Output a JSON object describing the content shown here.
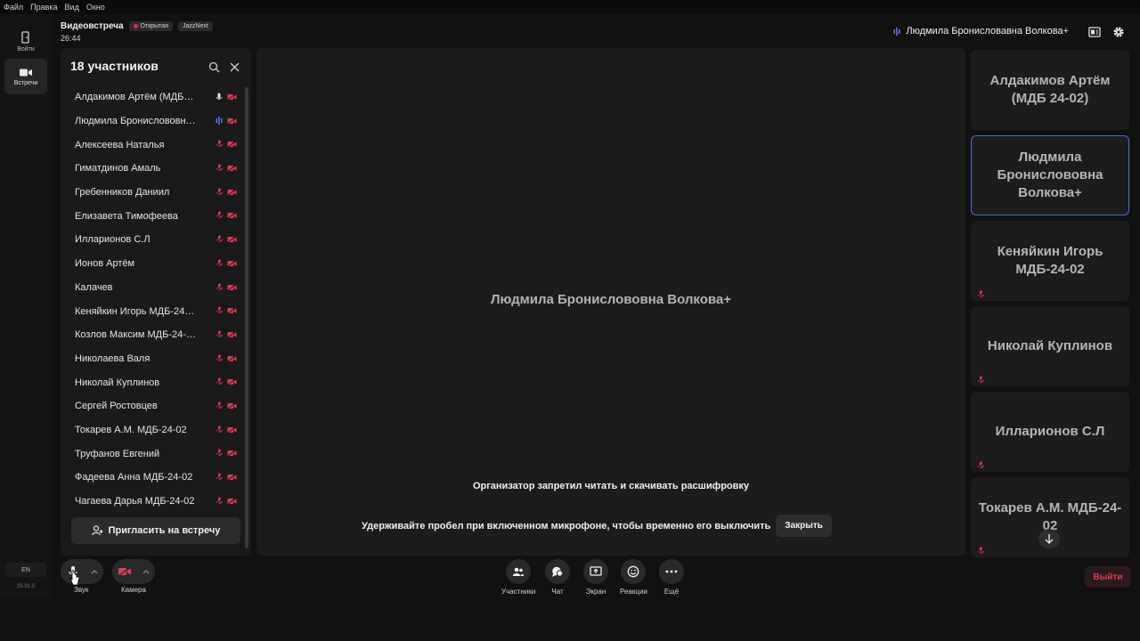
{
  "menu": [
    "Файл",
    "Правка",
    "Вид",
    "Окно"
  ],
  "rail": {
    "login_label": "Войти",
    "meetings_label": "Встречи",
    "lang": "EN",
    "version": "25.91.0"
  },
  "header": {
    "title": "Видеовстреча",
    "badge_open": "Открытая",
    "badge_brand": "JazzNext",
    "timer": "26:44",
    "active_speaker": "Людмила Бронисловавна Волкова+"
  },
  "participants": {
    "title": "18 участников",
    "invite_label": "Пригласить на встречу",
    "items": [
      {
        "name": "Алдакимов Артём (МДБ 24-02)",
        "mic": "on"
      },
      {
        "name": "Людмила Бронислововна Волкова+",
        "mic": "speaking"
      },
      {
        "name": "Алексеева Наталья",
        "mic": "off"
      },
      {
        "name": "Гиматдинов Амаль",
        "mic": "off"
      },
      {
        "name": "Гребенников Даниил",
        "mic": "off"
      },
      {
        "name": "Елизавета Тимофеева",
        "mic": "off"
      },
      {
        "name": "Илларионов С.Л",
        "mic": "off"
      },
      {
        "name": "Ионов Артём",
        "mic": "off"
      },
      {
        "name": "Калачев",
        "mic": "off"
      },
      {
        "name": "Кеняйкин Игорь МДБ-24-02",
        "mic": "off"
      },
      {
        "name": "Козлов Максим МДБ-24-02",
        "mic": "off"
      },
      {
        "name": "Николаева Валя",
        "mic": "off"
      },
      {
        "name": "Николай Куплинов",
        "mic": "off"
      },
      {
        "name": "Сергей Ростовцев",
        "mic": "off"
      },
      {
        "name": "Токарев А.М. МДБ-24-02",
        "mic": "off"
      },
      {
        "name": "Труфанов Евгений",
        "mic": "off"
      },
      {
        "name": "Фадеева Анна МДБ-24-02",
        "mic": "off"
      },
      {
        "name": "Чагаева Дарья МДБ-24-02",
        "mic": "off"
      }
    ]
  },
  "stage": {
    "speaker_name": "Людмила Бронислововна Волкова+",
    "notice_transcript": "Организатор запретил читать и скачивать расшифровку",
    "notice_space": "Удерживайте пробел при включенном микрофоне, чтобы временно его выключить",
    "close_label": "Закрыть"
  },
  "tiles": [
    {
      "name": "Алдакимов Артём (МДБ 24-02)",
      "muted": false,
      "active": false
    },
    {
      "name": "Людмила Бронислововна Волкова+",
      "muted": false,
      "active": true
    },
    {
      "name": "Кеняйкин Игорь МДБ-24-02",
      "muted": true,
      "active": false
    },
    {
      "name": "Николай Куплинов",
      "muted": true,
      "active": false
    },
    {
      "name": "Илларионов С.Л",
      "muted": true,
      "active": false
    },
    {
      "name": "Токарев А.М. МДБ-24-02",
      "muted": true,
      "active": false
    }
  ],
  "controls": {
    "sound_label": "Звук",
    "camera_label": "Камера",
    "participants_label": "Участники",
    "chat_label": "Чат",
    "screen_label": "Экран",
    "reactions_label": "Реакции",
    "more_label": "Ещё",
    "exit_label": "Выйти"
  },
  "colors": {
    "accent_blue": "#4a6fe0",
    "danger_red": "#e03a55",
    "background": "#111111"
  }
}
